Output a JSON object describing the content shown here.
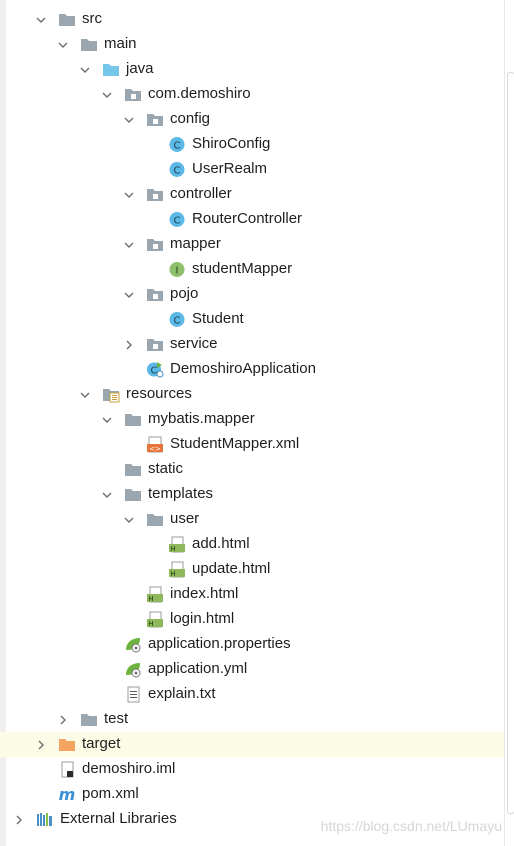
{
  "tree": {
    "watermark": "https://blog.csdn.net/LUmayu",
    "rows": [
      {
        "label": "src",
        "icon": "folder-icon",
        "arrow": "expanded",
        "level": 0
      },
      {
        "label": "main",
        "icon": "folder-icon",
        "arrow": "expanded",
        "level": 1
      },
      {
        "label": "java",
        "icon": "source-folder-icon",
        "arrow": "expanded",
        "level": 2
      },
      {
        "label": "com.demoshiro",
        "icon": "package-icon",
        "arrow": "expanded",
        "level": 3
      },
      {
        "label": "config",
        "icon": "package-icon",
        "arrow": "expanded",
        "level": 4
      },
      {
        "label": "ShiroConfig",
        "icon": "class-icon",
        "arrow": "none",
        "level": 5
      },
      {
        "label": "UserRealm",
        "icon": "class-icon",
        "arrow": "none",
        "level": 5
      },
      {
        "label": "controller",
        "icon": "package-icon",
        "arrow": "expanded",
        "level": 4
      },
      {
        "label": "RouterController",
        "icon": "class-icon",
        "arrow": "none",
        "level": 5
      },
      {
        "label": "mapper",
        "icon": "package-icon",
        "arrow": "expanded",
        "level": 4
      },
      {
        "label": "studentMapper",
        "icon": "interface-icon",
        "arrow": "none",
        "level": 5
      },
      {
        "label": "pojo",
        "icon": "package-icon",
        "arrow": "expanded",
        "level": 4
      },
      {
        "label": "Student",
        "icon": "class-icon",
        "arrow": "none",
        "level": 5
      },
      {
        "label": "service",
        "icon": "package-icon",
        "arrow": "collapsed",
        "level": 4
      },
      {
        "label": "DemoshiroApplication",
        "icon": "spring-boot-class-icon",
        "arrow": "none",
        "level": 4
      },
      {
        "label": "resources",
        "icon": "resources-folder-icon",
        "arrow": "expanded",
        "level": 2
      },
      {
        "label": "mybatis.mapper",
        "icon": "folder-icon",
        "arrow": "expanded",
        "level": 3
      },
      {
        "label": "StudentMapper.xml",
        "icon": "xml-file-icon",
        "arrow": "none",
        "level": 4
      },
      {
        "label": "static",
        "icon": "folder-icon",
        "arrow": "none",
        "level": 3
      },
      {
        "label": "templates",
        "icon": "folder-icon",
        "arrow": "expanded",
        "level": 3
      },
      {
        "label": "user",
        "icon": "folder-icon",
        "arrow": "expanded",
        "level": 4
      },
      {
        "label": "add.html",
        "icon": "html-file-icon",
        "arrow": "none",
        "level": 5
      },
      {
        "label": "update.html",
        "icon": "html-file-icon",
        "arrow": "none",
        "level": 5
      },
      {
        "label": "index.html",
        "icon": "html-file-icon",
        "arrow": "none",
        "level": 4
      },
      {
        "label": "login.html",
        "icon": "html-file-icon",
        "arrow": "none",
        "level": 4
      },
      {
        "label": "application.properties",
        "icon": "spring-properties-icon",
        "arrow": "none",
        "level": 3
      },
      {
        "label": "application.yml",
        "icon": "spring-properties-icon",
        "arrow": "none",
        "level": 3
      },
      {
        "label": "explain.txt",
        "icon": "text-file-icon",
        "arrow": "none",
        "level": 3
      },
      {
        "label": "test",
        "icon": "folder-icon",
        "arrow": "collapsed",
        "level": 1
      },
      {
        "label": "target",
        "icon": "excluded-folder-icon",
        "arrow": "collapsed",
        "level": 0,
        "selected": true
      },
      {
        "label": "demoshiro.iml",
        "icon": "iml-file-icon",
        "arrow": "none",
        "level": 0
      },
      {
        "label": "pom.xml",
        "icon": "maven-icon",
        "arrow": "none",
        "level": 0
      },
      {
        "label": "External Libraries",
        "icon": "libraries-icon",
        "arrow": "collapsed",
        "level": -1
      }
    ]
  },
  "colors": {
    "folder": "#9aa7b0",
    "source_folder": "#74c6ea",
    "class": "#5cb8e6",
    "interface": "#8ec06c",
    "excluded": "#f4a460",
    "html": "#8fb85a",
    "spring": "#6db33f",
    "selected_row": "#fbfbe6",
    "arrow": "#6e6e6e"
  }
}
